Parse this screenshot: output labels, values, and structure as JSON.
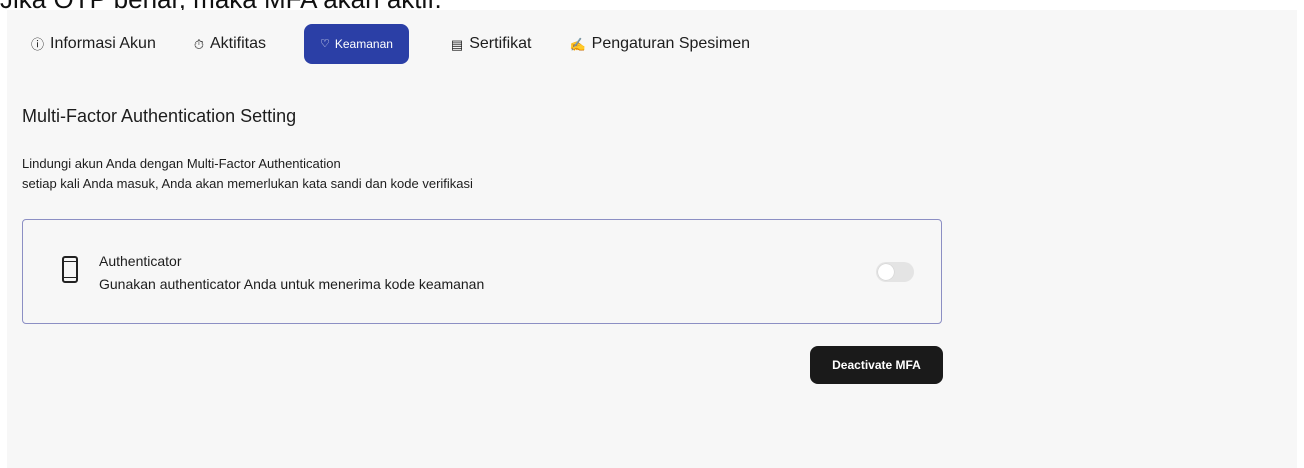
{
  "header_text": "Jika OTP benar, maka MFA akan aktif.",
  "tabs": [
    {
      "label": "Informasi Akun",
      "icon": "info-icon",
      "active": false
    },
    {
      "label": "Aktifitas",
      "icon": "activity-icon",
      "active": false
    },
    {
      "label": "Keamanan",
      "icon": "shield-icon",
      "active": true
    },
    {
      "label": "Sertifikat",
      "icon": "certificate-icon",
      "active": false
    },
    {
      "label": "Pengaturan Spesimen",
      "icon": "signature-icon",
      "active": false
    }
  ],
  "section": {
    "title": "Multi-Factor Authentication Setting",
    "description_line1": "Lindungi akun Anda dengan Multi-Factor Authentication",
    "description_line2": "setiap kali Anda masuk, Anda akan memerlukan kata sandi dan kode verifikasi"
  },
  "authenticator": {
    "name": "Authenticator",
    "description": "Gunakan authenticator Anda untuk menerima kode keamanan",
    "enabled": false
  },
  "actions": {
    "deactivate_label": "Deactivate MFA"
  },
  "colors": {
    "active_tab": "#2b3fa6",
    "card_border": "#8c8fc4",
    "panel_bg": "#f7f7f7",
    "button_bg": "#1a1a1a"
  }
}
